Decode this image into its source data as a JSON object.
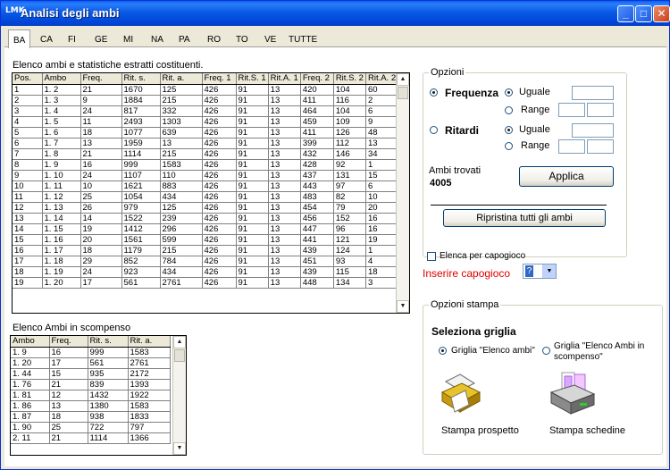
{
  "window": {
    "logo_text": "LMK",
    "title": "Analisi degli ambi",
    "min_glyph": "_",
    "max_glyph": "□",
    "close_glyph": "✕"
  },
  "tabs": [
    "BA",
    "CA",
    "FI",
    "GE",
    "MI",
    "NA",
    "PA",
    "RO",
    "TO",
    "VE",
    "TUTTE"
  ],
  "active_tab": "BA",
  "main_grid": {
    "label": "Elenco ambi e statistiche estratti costituenti.",
    "columns": [
      "Pos.",
      "Ambo",
      "Freq.",
      "Rit. s.",
      "Rit. a.",
      "Freq. 1",
      "Rit.S. 1",
      "Rit.A. 1",
      "Freq. 2",
      "Rit.S. 2",
      "Rit.A. 2"
    ],
    "rows": [
      [
        "1",
        "1. 2",
        "21",
        "1670",
        "125",
        "426",
        "91",
        "13",
        "420",
        "104",
        "60"
      ],
      [
        "2",
        "1. 3",
        "9",
        "1884",
        "215",
        "426",
        "91",
        "13",
        "411",
        "116",
        "2"
      ],
      [
        "3",
        "1. 4",
        "24",
        "817",
        "332",
        "426",
        "91",
        "13",
        "464",
        "104",
        "6"
      ],
      [
        "4",
        "1. 5",
        "11",
        "2493",
        "1303",
        "426",
        "91",
        "13",
        "459",
        "109",
        "9"
      ],
      [
        "5",
        "1. 6",
        "18",
        "1077",
        "639",
        "426",
        "91",
        "13",
        "411",
        "126",
        "48"
      ],
      [
        "6",
        "1. 7",
        "13",
        "1959",
        "13",
        "426",
        "91",
        "13",
        "399",
        "112",
        "13"
      ],
      [
        "7",
        "1. 8",
        "21",
        "1114",
        "215",
        "426",
        "91",
        "13",
        "432",
        "146",
        "34"
      ],
      [
        "8",
        "1. 9",
        "16",
        "999",
        "1583",
        "426",
        "91",
        "13",
        "428",
        "92",
        "1"
      ],
      [
        "9",
        "1. 10",
        "24",
        "1107",
        "110",
        "426",
        "91",
        "13",
        "437",
        "131",
        "15"
      ],
      [
        "10",
        "1. 11",
        "10",
        "1621",
        "883",
        "426",
        "91",
        "13",
        "443",
        "97",
        "6"
      ],
      [
        "11",
        "1. 12",
        "25",
        "1054",
        "434",
        "426",
        "91",
        "13",
        "483",
        "82",
        "10"
      ],
      [
        "12",
        "1. 13",
        "26",
        "979",
        "125",
        "426",
        "91",
        "13",
        "454",
        "79",
        "20"
      ],
      [
        "13",
        "1. 14",
        "14",
        "1522",
        "239",
        "426",
        "91",
        "13",
        "456",
        "152",
        "16"
      ],
      [
        "14",
        "1. 15",
        "19",
        "1412",
        "296",
        "426",
        "91",
        "13",
        "447",
        "96",
        "16"
      ],
      [
        "15",
        "1. 16",
        "20",
        "1561",
        "599",
        "426",
        "91",
        "13",
        "441",
        "121",
        "19"
      ],
      [
        "16",
        "1. 17",
        "18",
        "1179",
        "215",
        "426",
        "91",
        "13",
        "439",
        "124",
        "1"
      ],
      [
        "17",
        "1. 18",
        "29",
        "852",
        "784",
        "426",
        "91",
        "13",
        "451",
        "93",
        "4"
      ],
      [
        "18",
        "1. 19",
        "24",
        "923",
        "434",
        "426",
        "91",
        "13",
        "439",
        "115",
        "18"
      ],
      [
        "19",
        "1. 20",
        "17",
        "561",
        "2761",
        "426",
        "91",
        "13",
        "448",
        "134",
        "3"
      ]
    ]
  },
  "scompenso_grid": {
    "label": "Elenco Ambi in scompenso",
    "columns": [
      "Ambo",
      "Freq.",
      "Rit. s.",
      "Rit. a."
    ],
    "rows": [
      [
        "1. 9",
        "16",
        "999",
        "1583"
      ],
      [
        "1. 20",
        "17",
        "561",
        "2761"
      ],
      [
        "1. 44",
        "15",
        "935",
        "2172"
      ],
      [
        "1. 76",
        "21",
        "839",
        "1393"
      ],
      [
        "1. 81",
        "12",
        "1432",
        "1922"
      ],
      [
        "1. 86",
        "13",
        "1380",
        "1583"
      ],
      [
        "1. 87",
        "18",
        "938",
        "1833"
      ],
      [
        "1. 90",
        "25",
        "722",
        "797"
      ],
      [
        "2. 11",
        "21",
        "1114",
        "1366"
      ]
    ]
  },
  "opzioni": {
    "title": "Opzioni",
    "frequenza_label": "Frequenza",
    "ritardi_label": "Ritardi",
    "uguale_label": "Uguale",
    "range_label": "Range",
    "ambi_trovati_label": "Ambi trovati",
    "ambi_trovati_value": "4005",
    "applica_label": "Applica",
    "ripristina_label": "Ripristina tutti gli ambi"
  },
  "capogioco": {
    "checkbox_label": "Elenca per capogioco",
    "prompt_label": "Inserire capogioco",
    "combo_value": "?"
  },
  "stampa": {
    "title": "Opzioni stampa",
    "seleziona_label": "Seleziona griglia",
    "griglia1_label": "Griglia \"Elenco ambi\"",
    "griglia2_line1": "Griglia \"Elenco Ambi in",
    "griglia2_line2": "scompenso\"",
    "prospetto_label": "Stampa prospetto",
    "schedine_label": "Stampa schedine"
  },
  "scroll": {
    "up_glyph": "▲",
    "down_glyph": "▼"
  }
}
